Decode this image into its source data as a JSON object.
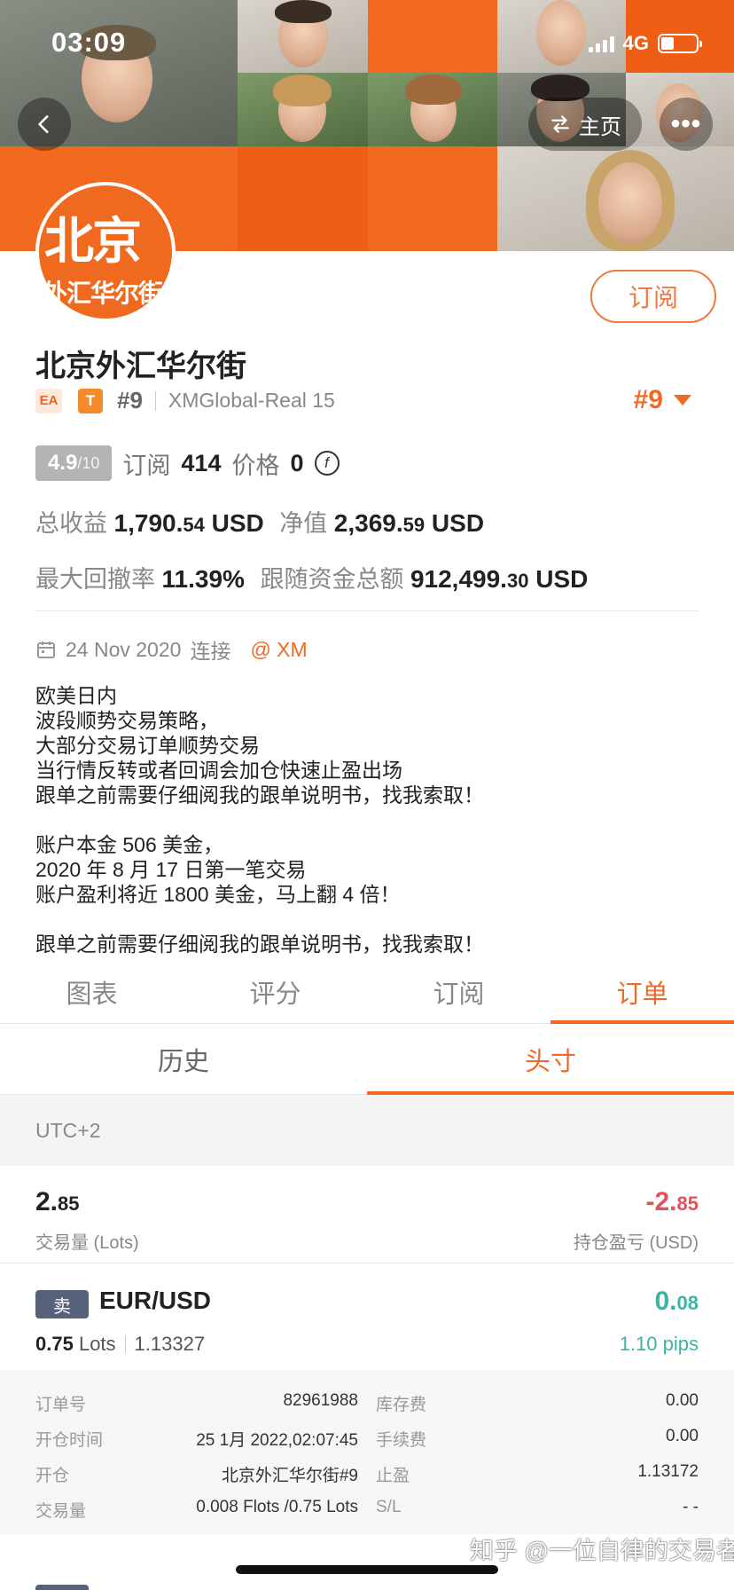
{
  "status_bar": {
    "time": "03:09",
    "network": "4G"
  },
  "nav": {
    "home_label": "主页"
  },
  "profile": {
    "avatar_big": "北京",
    "avatar_small": "外汇华尔街",
    "subscribe_label": "订阅",
    "name": "北京外汇华尔街",
    "tag_ea": "EA",
    "tag_t": "T",
    "rank": "#9",
    "server": "XMGlobal-Real 15",
    "rank_right": "#9"
  },
  "stats": {
    "score": "4.9",
    "score_max": "/10",
    "subscribe_label": "订阅",
    "subscribe_count": "414",
    "price_label": "价格",
    "price_value": "0",
    "total_profit_label": "总收益",
    "total_profit_main": "1,790.",
    "total_profit_dec": "54",
    "total_profit_unit": "USD",
    "equity_label": "净值",
    "equity_main": "2,369.",
    "equity_dec": "59",
    "equity_unit": "USD",
    "drawdown_label": "最大回撤率",
    "drawdown_value": "11.39%",
    "follow_funds_label": "跟随资金总额",
    "follow_funds_main": "912,499.",
    "follow_funds_dec": "30",
    "follow_funds_unit": "USD"
  },
  "connection": {
    "date": "24 Nov 2020",
    "label": "连接",
    "broker": "@ XM"
  },
  "description": [
    "欧美日内",
    "波段顺势交易策略，",
    "大部分交易订单顺势交易",
    "当行情反转或者回调会加仓快速止盈出场",
    "跟单之前需要仔细阅我的跟单说明书，找我索取！",
    "",
    "账户本金 506 美金，",
    "2020 年 8 月 17 日第一笔交易",
    "账户盈利将近 1800 美金，马上翻 4 倍！",
    "",
    "跟单之前需要仔细阅我的跟单说明书，找我索取！"
  ],
  "tabs": [
    {
      "label": "图表"
    },
    {
      "label": "评分"
    },
    {
      "label": "订阅"
    },
    {
      "label": "订单"
    }
  ],
  "subtabs": [
    {
      "label": "历史"
    },
    {
      "label": "头寸"
    }
  ],
  "timezone": "UTC+2",
  "summary": {
    "volume_main": "2.",
    "volume_dec": "85",
    "volume_label": "交易量 (Lots)",
    "pnl_main": "-2.",
    "pnl_dec": "85",
    "pnl_label": "持仓盈亏 (USD)"
  },
  "order": {
    "side": "卖",
    "pair": "EUR/USD",
    "lots_value": "0.75",
    "lots_unit": "Lots",
    "price": "1.13327",
    "profit_main": "0.",
    "profit_dec": "08",
    "pips": "1.10 pips",
    "details": [
      {
        "k1": "订单号",
        "v1": "82961988",
        "k2": "库存费",
        "v2": "0.00"
      },
      {
        "k1": "开仓时间",
        "v1": "25 1月 2022,02:07:45",
        "k2": "手续费",
        "v2": "0.00"
      },
      {
        "k1": "开仓",
        "v1": "北京外汇华尔街#9",
        "k2": "止盈",
        "v2": "1.13172"
      },
      {
        "k1": "交易量",
        "v1": "0.008 Flots /0.75 Lots",
        "k2": "S/L",
        "v2": "- -"
      }
    ]
  },
  "watermark": "知乎 @一位自律的交易者",
  "colors": {
    "accent": "#ef6a24",
    "loss": "#e0525c",
    "gain": "#3ab5a4"
  }
}
